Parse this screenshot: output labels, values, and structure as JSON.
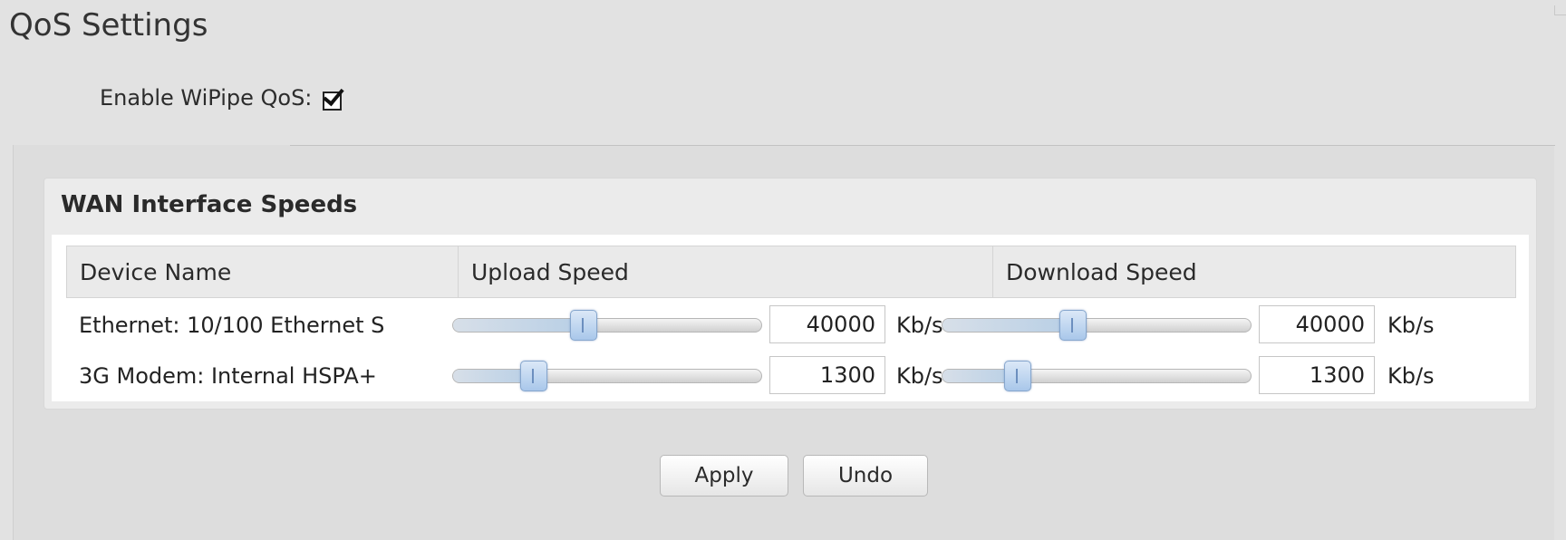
{
  "page_title": "QoS Settings",
  "enable_qos": {
    "label": "Enable WiPipe QoS:",
    "checked": true
  },
  "wan_panel": {
    "title": "WAN Interface Speeds",
    "columns": [
      "Device Name",
      "Upload Speed",
      "Download Speed"
    ],
    "rows": [
      {
        "device": "Ethernet: 10/100 Ethernet S",
        "upload": {
          "value": "40000",
          "unit": "Kb/s",
          "slider_level": 0.42
        },
        "download": {
          "value": "40000",
          "unit": "Kb/s",
          "slider_level": 0.42
        }
      },
      {
        "device": "3G Modem: Internal HSPA+",
        "upload": {
          "value": "1300",
          "unit": "Kb/s",
          "slider_level": 0.26
        },
        "download": {
          "value": "1300",
          "unit": "Kb/s",
          "slider_level": 0.24
        }
      }
    ]
  },
  "buttons": {
    "apply": "Apply",
    "undo": "Undo"
  }
}
